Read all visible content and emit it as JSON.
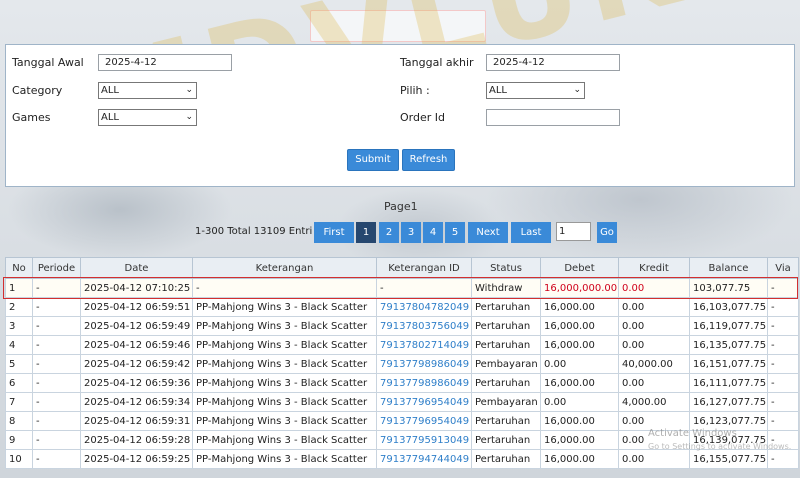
{
  "filter": {
    "tanggal_awal_label": "Tanggal Awal",
    "tanggal_awal_value": "2025-4-12",
    "tanggal_akhir_label": "Tanggal akhir",
    "tanggal_akhir_value": "2025-4-12",
    "category_label": "Category",
    "category_value": "ALL",
    "pilih_label": "Pilih  :",
    "pilih_value": "ALL",
    "games_label": "Games",
    "games_value": "ALL",
    "order_id_label": "Order Id",
    "order_id_value": "",
    "submit_label": "Submit",
    "refresh_label": "Refresh"
  },
  "pagination": {
    "page_label": "Page1",
    "total_text": "1-300 Total 13109 Entri",
    "first": "First",
    "pages": [
      "1",
      "2",
      "3",
      "4",
      "5"
    ],
    "next": "Next",
    "last": "Last",
    "input_value": "1",
    "go": "Go"
  },
  "table": {
    "headers": [
      "No",
      "Periode",
      "Date",
      "Keterangan",
      "Keterangan ID",
      "Status",
      "Debet",
      "Kredit",
      "Balance",
      "Via"
    ],
    "rows": [
      [
        "1",
        "-",
        "2025-04-12 07:10:25",
        "-",
        "-",
        "Withdraw",
        "16,000,000.00",
        "0.00",
        "103,077.75",
        "-"
      ],
      [
        "2",
        "-",
        "2025-04-12 06:59:51",
        "PP-Mahjong Wins 3 - Black Scatter",
        "79137804782049",
        "Pertaruhan",
        "16,000.00",
        "0.00",
        "16,103,077.75",
        "-"
      ],
      [
        "3",
        "-",
        "2025-04-12 06:59:49",
        "PP-Mahjong Wins 3 - Black Scatter",
        "79137803756049",
        "Pertaruhan",
        "16,000.00",
        "0.00",
        "16,119,077.75",
        "-"
      ],
      [
        "4",
        "-",
        "2025-04-12 06:59:46",
        "PP-Mahjong Wins 3 - Black Scatter",
        "79137802714049",
        "Pertaruhan",
        "16,000.00",
        "0.00",
        "16,135,077.75",
        "-"
      ],
      [
        "5",
        "-",
        "2025-04-12 06:59:42",
        "PP-Mahjong Wins 3 - Black Scatter",
        "79137798986049",
        "Pembayaran",
        "0.00",
        "40,000.00",
        "16,151,077.75",
        "-"
      ],
      [
        "6",
        "-",
        "2025-04-12 06:59:36",
        "PP-Mahjong Wins 3 - Black Scatter",
        "79137798986049",
        "Pertaruhan",
        "16,000.00",
        "0.00",
        "16,111,077.75",
        "-"
      ],
      [
        "7",
        "-",
        "2025-04-12 06:59:34",
        "PP-Mahjong Wins 3 - Black Scatter",
        "79137796954049",
        "Pembayaran",
        "0.00",
        "4,000.00",
        "16,127,077.75",
        "-"
      ],
      [
        "8",
        "-",
        "2025-04-12 06:59:31",
        "PP-Mahjong Wins 3 - Black Scatter",
        "79137796954049",
        "Pertaruhan",
        "16,000.00",
        "0.00",
        "16,123,077.75",
        "-"
      ],
      [
        "9",
        "-",
        "2025-04-12 06:59:28",
        "PP-Mahjong Wins 3 - Black Scatter",
        "79137795913049",
        "Pertaruhan",
        "16,000.00",
        "0.00",
        "16,139,077.75",
        "-"
      ],
      [
        "10",
        "-",
        "2025-04-12 06:59:25",
        "PP-Mahjong Wins 3 - Black Scatter",
        "79137794744049",
        "Pertaruhan",
        "16,000.00",
        "0.00",
        "16,155,077.75",
        "-"
      ]
    ]
  },
  "watermark": "MDVLUK",
  "activate_windows": {
    "title": "Activate Windows",
    "subtitle": "Go to Settings to activate Windows."
  },
  "colors": {
    "accent": "#3a8ad8",
    "active_page": "#26476f",
    "highlight_border": "#d32f2f",
    "debit_red": "#d0021b",
    "link_blue": "#2f7fc9"
  }
}
